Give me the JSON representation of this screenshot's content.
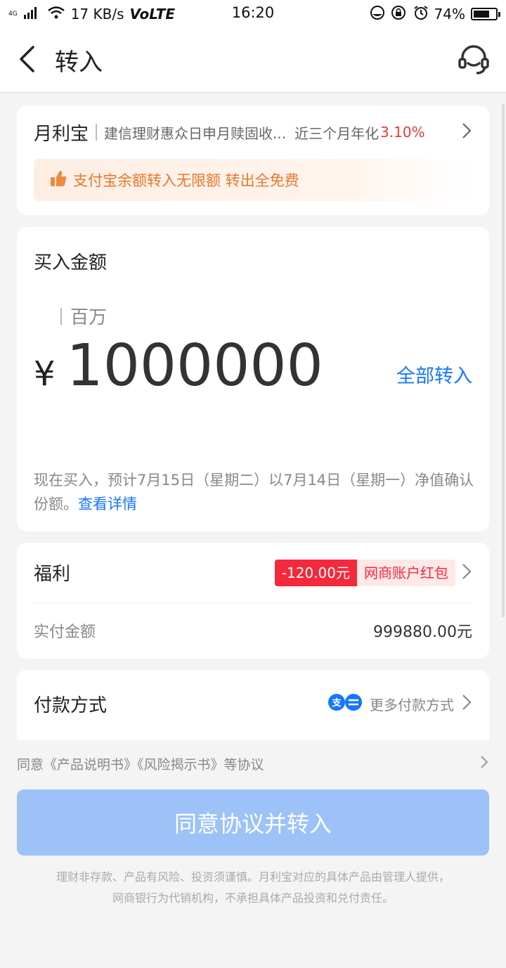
{
  "status_bar": {
    "network": "4G",
    "speed": "17 KB/s",
    "volte": "VoLTE",
    "time": "16:20",
    "battery": "74%",
    "battery_level": 0.74
  },
  "nav": {
    "title": "转入",
    "back_icon": "chevron-left-icon",
    "service_icon": "headset-icon"
  },
  "product": {
    "name": "月利宝",
    "description": "建信理财惠众日申月赎固收...",
    "yield_label": "近三个月年化",
    "yield_value": "3.10%",
    "promo_text": "支付宝余额转入无限额 转出全免费",
    "promo_icon": "thumbs-up-icon"
  },
  "amount": {
    "label": "买入金额",
    "unit_hint": "百万",
    "currency": "¥",
    "value": "1000000",
    "all_in_label": "全部转入",
    "confirm_note": "现在买入，预计7月15日（星期二）以7月14日（星期一）净值确认份额。",
    "detail_link": "查看详情"
  },
  "benefit": {
    "label": "福利",
    "tag_amount": "-120.00元",
    "tag_name": "网商账户红包",
    "pay_label": "实付金额",
    "pay_value": "999880.00元"
  },
  "method": {
    "label": "付款方式",
    "more_label": "更多付款方式",
    "icon": "alipay-icon"
  },
  "agreement": {
    "text": "同意《产品说明书》《风险揭示书》等协议"
  },
  "submit": {
    "label": "同意协议并转入"
  },
  "disclaimer": {
    "line1": "理财非存款、产品有风险、投资须谨慎。月利宝对应的具体产品由管理人提供，",
    "line2": "网商银行为代销机构，不承担具体产品投资和兑付责任。"
  },
  "colors": {
    "accent_blue": "#1677ff",
    "yield_red": "#e4393c",
    "promo_orange": "#e8772c",
    "tag_red": "#f5293c",
    "button_disabled": "#9dc2f7"
  }
}
